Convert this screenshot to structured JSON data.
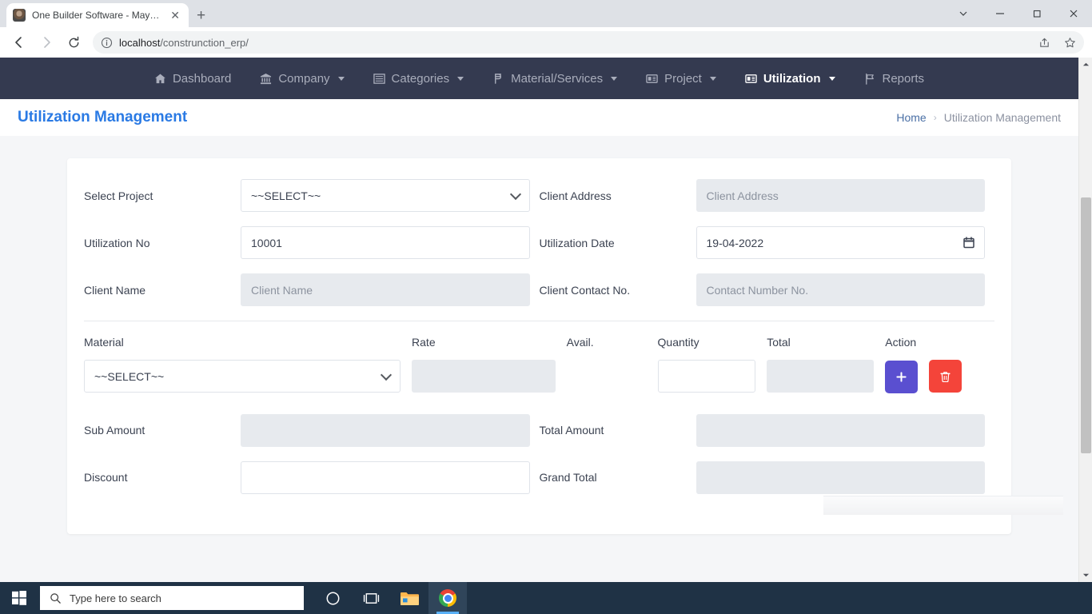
{
  "browser": {
    "tab_title": "One Builder Software - Mayuri K",
    "tab_close_label": "✕",
    "new_tab_label": "+",
    "url_host": "localhost",
    "url_path": "/construnction_erp/",
    "window_controls": {
      "tab_search": "⌄",
      "minimize": "—",
      "maximize": "❐",
      "close": "✕"
    }
  },
  "navbar": {
    "items": [
      {
        "label": "Dashboard",
        "icon": "home-icon",
        "caret": false,
        "active": false
      },
      {
        "label": "Company",
        "icon": "bank-icon",
        "caret": true,
        "active": false
      },
      {
        "label": "Categories",
        "icon": "list-icon",
        "caret": true,
        "active": false
      },
      {
        "label": "Material/Services",
        "icon": "rupee-icon",
        "caret": true,
        "active": false
      },
      {
        "label": "Project",
        "icon": "card-icon",
        "caret": true,
        "active": false
      },
      {
        "label": "Utilization",
        "icon": "card-icon",
        "caret": true,
        "active": true
      },
      {
        "label": "Reports",
        "icon": "flag-icon",
        "caret": false,
        "active": false
      }
    ]
  },
  "header": {
    "title": "Utilization Management",
    "breadcrumb_home": "Home",
    "breadcrumb_sep": "›",
    "breadcrumb_current": "Utilization Management"
  },
  "form": {
    "select_project": {
      "label": "Select Project",
      "value": "~~SELECT~~"
    },
    "client_address": {
      "label": "Client Address",
      "placeholder": "Client Address",
      "value": ""
    },
    "utilization_no": {
      "label": "Utilization No",
      "value": "10001"
    },
    "utilization_date": {
      "label": "Utilization Date",
      "value": "19-04-2022"
    },
    "client_name": {
      "label": "Client Name",
      "placeholder": "Client Name",
      "value": ""
    },
    "client_contact": {
      "label": "Client Contact No.",
      "placeholder": "Contact Number No.",
      "value": ""
    }
  },
  "table": {
    "columns": [
      "Material",
      "Rate",
      "Avail.",
      "Quantity",
      "Total",
      "Action"
    ],
    "rows": [
      {
        "material": "~~SELECT~~",
        "rate": "",
        "avail": "",
        "quantity": "",
        "total": "",
        "add_label": "+",
        "delete_label": "🗑"
      }
    ]
  },
  "summary": {
    "sub_amount": {
      "label": "Sub Amount",
      "value": ""
    },
    "total_amount": {
      "label": "Total Amount",
      "value": ""
    },
    "discount": {
      "label": "Discount",
      "value": ""
    },
    "grand_total": {
      "label": "Grand Total",
      "value": ""
    }
  },
  "colors": {
    "navbar_bg": "#343a50",
    "title_blue": "#2a7ae4",
    "add_button": "#5a4fd0",
    "delete_button": "#f4443a",
    "disabled_field": "#e7eaee"
  },
  "taskbar": {
    "search_placeholder": "Type here to search",
    "items": [
      "cortana-icon",
      "task-view-icon",
      "file-explorer-icon",
      "chrome-icon"
    ]
  }
}
